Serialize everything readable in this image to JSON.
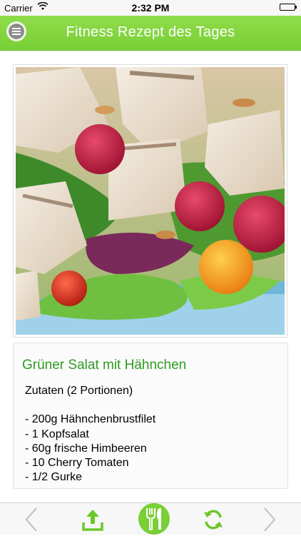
{
  "status_bar": {
    "carrier": "Carrier",
    "time": "2:32 PM"
  },
  "nav": {
    "title": "Fitness Rezept des Tages",
    "menu_icon": "hamburger-menu-icon"
  },
  "photo": {
    "description_icon": "salad-photo"
  },
  "recipe": {
    "title": "Grüner Salat mit Hähnchen",
    "ingredients_heading": "Zutaten (2 Portionen)",
    "ingredients": [
      "- 200g Hähnchenbrustfilet",
      "- 1 Kopfsalat",
      "- 60g frische Himbeeren",
      "- 10 Cherry Tomaten",
      "- 1/2 Gurke"
    ]
  },
  "toolbar": {
    "back_icon": "chevron-left-icon",
    "share_icon": "share-icon",
    "recipes_icon": "fork-knife-icon",
    "refresh_icon": "refresh-icon",
    "forward_icon": "chevron-right-icon"
  },
  "colors": {
    "nav_green": "#79cf36",
    "title_green": "#2f9a22",
    "icon_green": "#6cc72a"
  }
}
